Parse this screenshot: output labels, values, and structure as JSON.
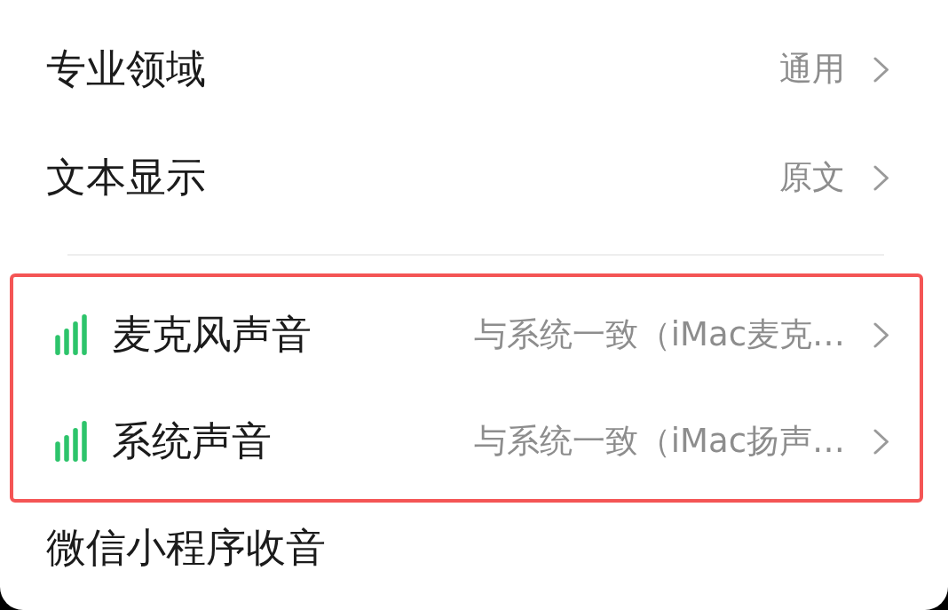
{
  "settings": [
    {
      "label": "专业领域",
      "value": "通用"
    },
    {
      "label": "文本显示",
      "value": "原文"
    }
  ],
  "audio_section": {
    "highlighted": true,
    "items": [
      {
        "label": "麦克风声音",
        "value": "与系统一致（iMac麦克…"
      },
      {
        "label": "系统声音",
        "value": "与系统一致（iMac扬声…"
      }
    ]
  },
  "footer_item": {
    "label": "微信小程序收音"
  }
}
